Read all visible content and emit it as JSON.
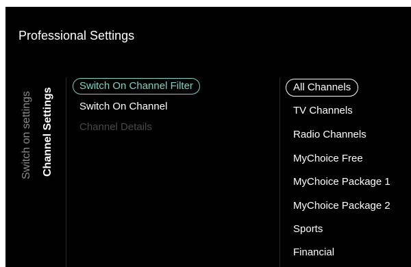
{
  "header": {
    "title": "Professional Settings"
  },
  "breadcrumb": {
    "parent": "Switch on settings",
    "current": "Channel Settings"
  },
  "menu": {
    "items": [
      {
        "label": "Switch On Channel Filter",
        "state": "active"
      },
      {
        "label": "Switch On Channel",
        "state": "normal"
      },
      {
        "label": "Channel Details",
        "state": "disabled"
      }
    ]
  },
  "options": {
    "selected": "All Channels",
    "items": [
      {
        "label": "All Channels"
      },
      {
        "label": "TV Channels"
      },
      {
        "label": "Radio Channels"
      },
      {
        "label": "MyChoice Free"
      },
      {
        "label": "MyChoice Package 1"
      },
      {
        "label": "MyChoice Package 2"
      },
      {
        "label": "Sports"
      },
      {
        "label": "Financial"
      }
    ]
  },
  "colors": {
    "background": "#000000",
    "accent": "#7fd2c2",
    "text": "#ffffff",
    "muted": "#8a8a8a",
    "disabled": "#4a4a4a"
  }
}
